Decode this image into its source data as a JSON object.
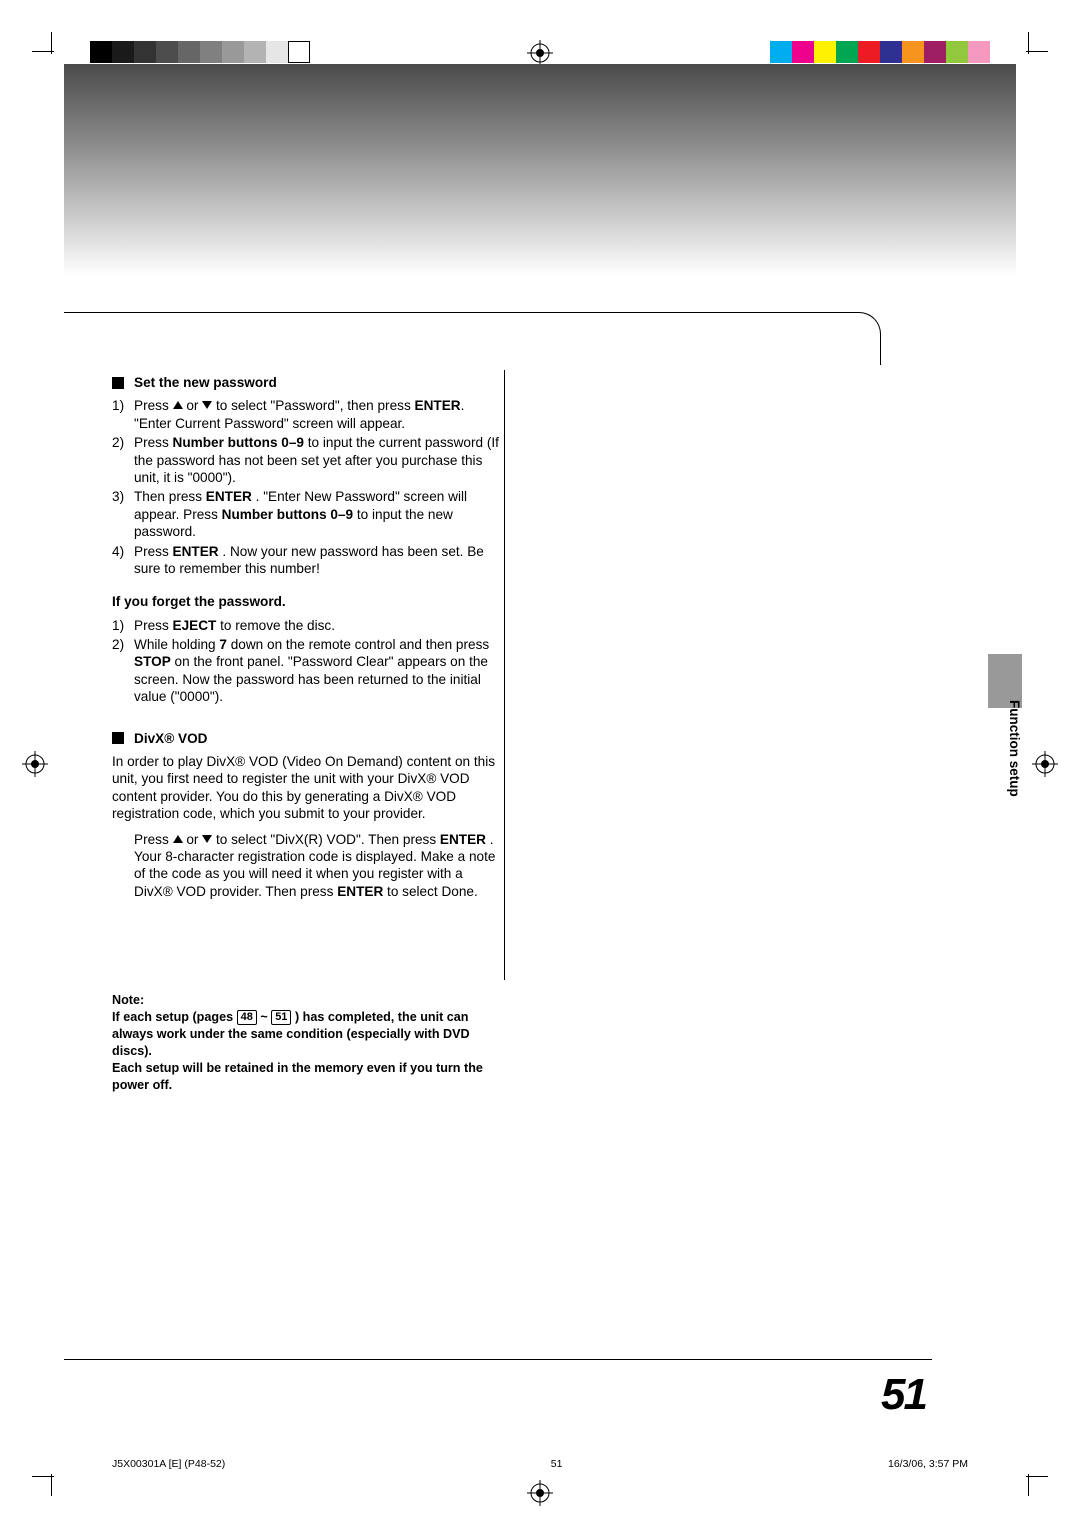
{
  "sections": {
    "set_password": {
      "title": "Set the new password",
      "step1_a": "Press ",
      "step1_b": " or ",
      "step1_c": " to select \"Password\", then press ",
      "step1_enter": "ENTER",
      "step1_d": ". \"Enter Current Password\" screen will appear.",
      "step2_a": "Press ",
      "step2_num": "Number buttons 0–9",
      "step2_b": " to input the current password (If the password has not been set yet after you purchase this unit, it is \"0000\").",
      "step3_a": "Then press ",
      "step3_enter": "ENTER",
      "step3_b": ". \"Enter New Password\" screen will appear. Press ",
      "step3_num": "Number buttons 0–9",
      "step3_c": " to input the new password.",
      "step4_a": "Press ",
      "step4_enter": "ENTER",
      "step4_b": ". Now your new password has been set. Be sure to remember this number!"
    },
    "forget_password": {
      "title": "If you forget the password.",
      "step1_a": "Press ",
      "step1_eject": "EJECT",
      "step1_b": " to remove the disc.",
      "step2_a": "While holding ",
      "step2_7": "7",
      "step2_b": " down on the remote control and then press ",
      "step2_stop": "STOP",
      "step2_c": " on the front panel. \"Password Clear\" appears on the screen. Now the password has been returned to the initial value (\"0000\")."
    },
    "divx": {
      "title": "DivX® VOD",
      "para1": "In order to play DivX® VOD (Video On Demand) content on this unit, you first need to register the unit with your DivX® VOD content provider. You do this by generating a DivX® VOD registration code, which you submit to your provider.",
      "para2_a": "Press ",
      "para2_b": " or ",
      "para2_c": " to select \"DivX(R) VOD\". Then press ",
      "para2_enter": "ENTER",
      "para2_d": ". Your 8-character registration code is displayed. Make a note of the code as you will need it when you register with a DivX® VOD provider. Then press ",
      "para2_enter2": "ENTER",
      "para2_e": " to select Done."
    }
  },
  "note": {
    "label": "Note:",
    "line1_a": "If each setup (pages ",
    "line1_pg1": "48",
    "line1_tilde": " ~ ",
    "line1_pg2": "51",
    "line1_b": " ) has completed, the unit can always work under the same condition (especially with DVD discs).",
    "line2": "Each setup will be retained in the memory even if you turn the power off."
  },
  "side_label": "Function setup",
  "page_number": "51",
  "footer": {
    "left": "J5X00301A [E] (P48-52)",
    "center": "51",
    "right": "16/3/06, 3:57 PM"
  },
  "color_swatches": {
    "gray": [
      "#000000",
      "#1a1a1a",
      "#333333",
      "#4d4d4d",
      "#666666",
      "#808080",
      "#999999",
      "#b3b3b3",
      "#e6e6e6",
      "#ffffff"
    ],
    "cmyk": [
      "#00aeef",
      "#ec008c",
      "#fff200",
      "#00a651",
      "#ed1c24",
      "#2e3192",
      "#f7941d",
      "#9e1f63",
      "#92c83e",
      "#f49ac1"
    ]
  }
}
